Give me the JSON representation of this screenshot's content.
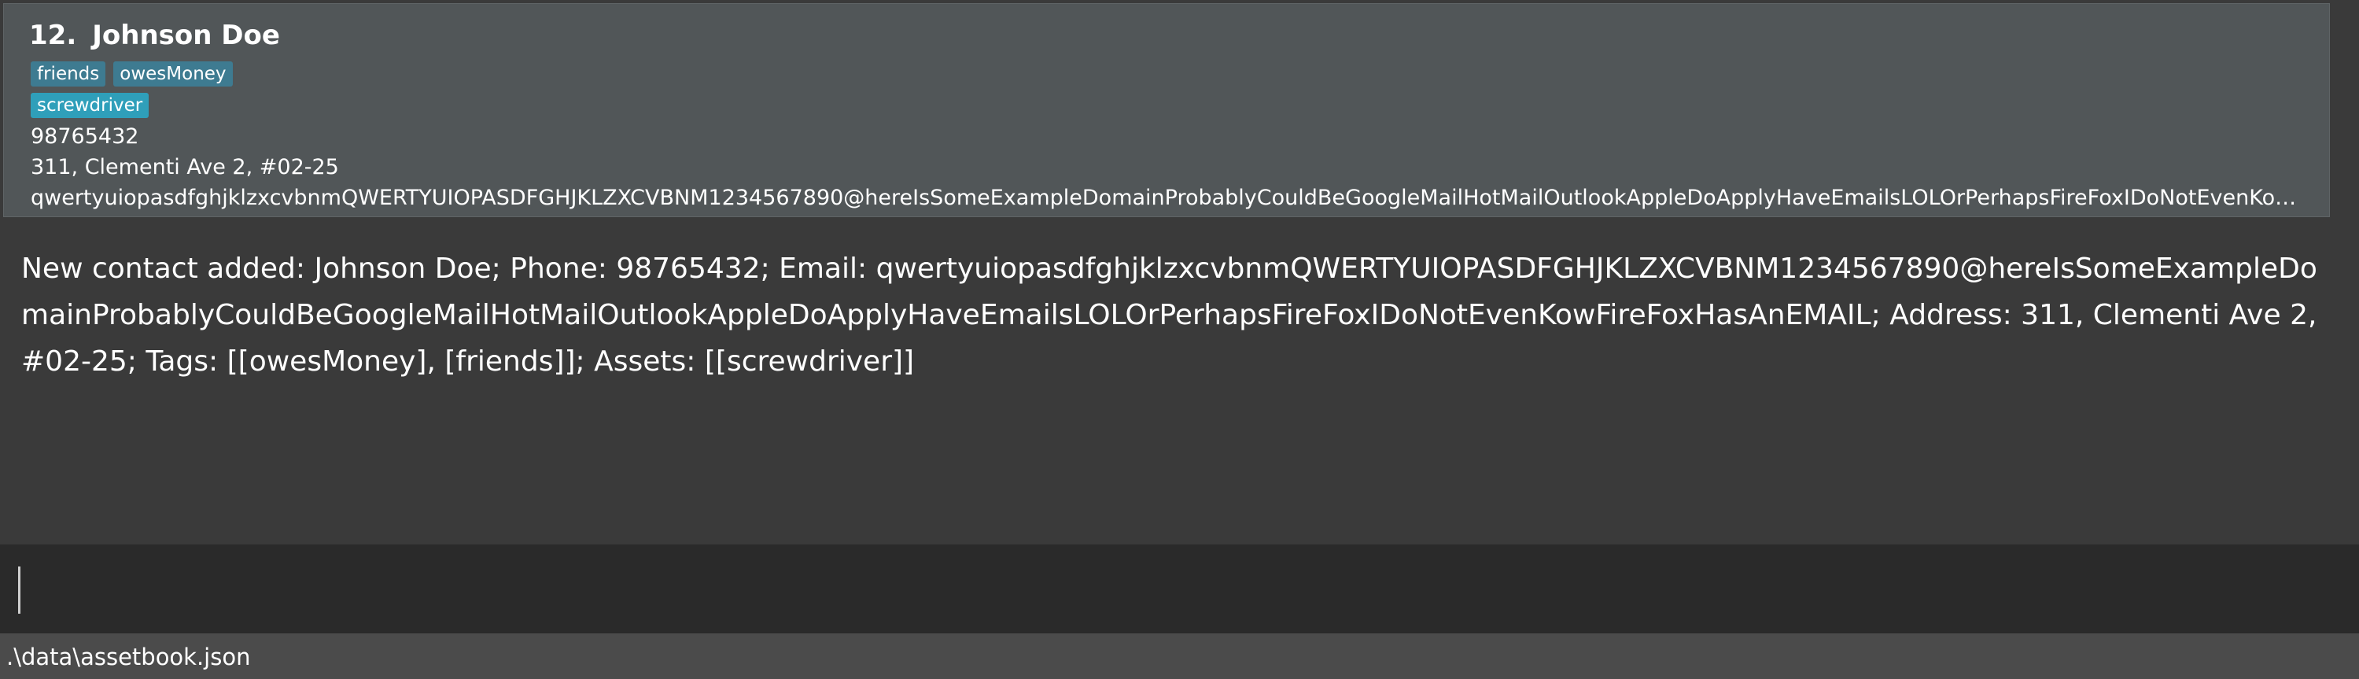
{
  "person_card": {
    "index": "12.",
    "name": "Johnson Doe",
    "tags": [
      "friends",
      "owesMoney"
    ],
    "assets": [
      "screwdriver"
    ],
    "phone": "98765432",
    "address": "311, Clementi Ave 2, #02-25",
    "email": "qwertyuiopasdfghjklzxcvbnmQWERTYUIOPASDFGHJKLZXCVBNM1234567890@hereIsSomeExampleDomainProbablyCouldBeGoogleMailHotMailOutlookAppleDoApplyHaveEmailsLOLOrPerhapsFireFoxIDoNotEvenKowFireFoxHasAnEMAIL"
  },
  "result_display": {
    "message": "New contact added: Johnson Doe; Phone: 98765432; Email: qwertyuiopasdfghjklzxcvbnmQWERTYUIOPASDFGHJKLZXCVBNM1234567890@hereIsSomeExampleDomainProbablyCouldBeGoogleMailHotMailOutlookAppleDoApplyHaveEmailsLOLOrPerhapsFireFoxIDoNotEvenKowFireFoxHasAnEMAIL; Address: 311, Clementi Ave 2, #02-25; Tags: [[owesMoney], [friends]]; Assets: [[screwdriver]]"
  },
  "command_box": {
    "value": ""
  },
  "status_bar": {
    "save_location": ".\\data\\assetbook.json"
  },
  "colors": {
    "background": "#3a3a3a",
    "card_background": "#515658",
    "tag_chip": "#3e7b91",
    "asset_chip": "#2f9fba",
    "command_background": "#2a2a2a",
    "status_background": "#4b4b4b"
  }
}
